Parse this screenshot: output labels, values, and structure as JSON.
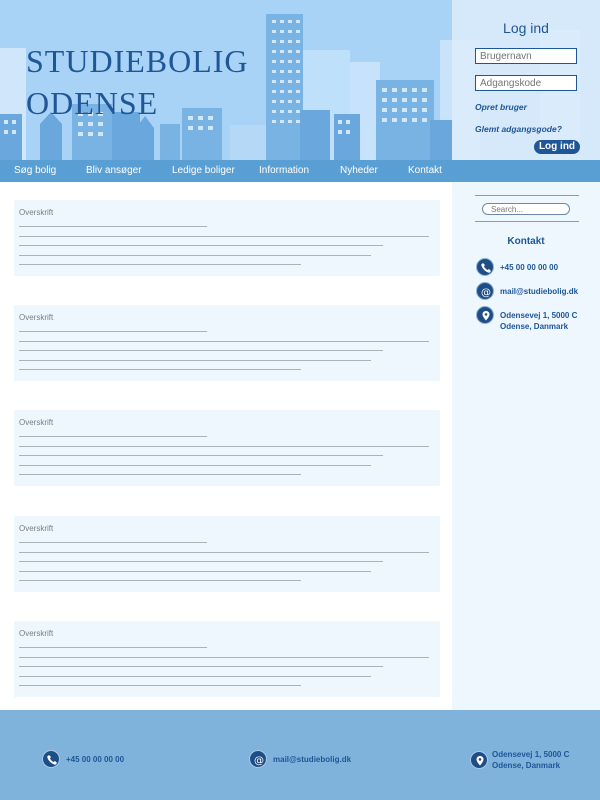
{
  "brand": {
    "line1": "STUDIEBOLIG",
    "line2": "ODENSE"
  },
  "login": {
    "title": "Log ind",
    "username_placeholder": "Brugernavn",
    "password_placeholder": "Adgangskode",
    "create_user": "Opret bruger",
    "forgot_password": "Glemt adgangsgode?",
    "button": "Log ind"
  },
  "nav": {
    "items": [
      "Søg bolig",
      "Bliv ansøger",
      "Ledige boliger",
      "Information",
      "Nyheder",
      "Kontakt"
    ]
  },
  "sidebar": {
    "search_placeholder": "Search...",
    "contact_title": "Kontakt",
    "phone": "+45 00 00 00 00",
    "email": "mail@studiebolig.dk",
    "address_line1": "Odensevej 1, 5000 C",
    "address_line2": "Odense, Danmark"
  },
  "cards": [
    {
      "title": "Overskrift"
    },
    {
      "title": "Overskrift"
    },
    {
      "title": "Overskrift"
    },
    {
      "title": "Overskrift"
    },
    {
      "title": "Overskrift"
    }
  ],
  "footer": {
    "phone": "+45 00 00 00 00",
    "email": "mail@studiebolig.dk",
    "address_line1": "Odensevej 1, 5000 C",
    "address_line2": "Odense, Danmark"
  },
  "icons": {
    "phone": "phone-icon",
    "email": "at-icon",
    "address": "location-icon",
    "search": "search-field"
  },
  "colors": {
    "brand": "#1f5697",
    "header_bg": "#a9d3f6",
    "nav_bg": "#5a9fd4",
    "sidebar_bg": "#eef6fe",
    "footer_bg": "#7fb3dc"
  }
}
